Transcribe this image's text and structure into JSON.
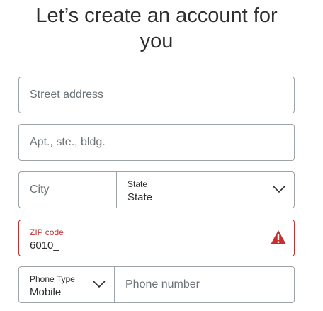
{
  "heading": {
    "line1": "Let’s create an account for",
    "line2": "you"
  },
  "street": {
    "placeholder": "Street address"
  },
  "apt": {
    "placeholder": "Apt., ste., bldg."
  },
  "city": {
    "placeholder": "City"
  },
  "state": {
    "label": "State",
    "value": "State"
  },
  "zip": {
    "label": "ZIP code",
    "value": "6010_",
    "error_color": "#c72e2e"
  },
  "phone_type": {
    "label": "Phone Type",
    "value": "Mobile"
  },
  "phone": {
    "placeholder": "Phone number"
  },
  "icons": {
    "state_chevron": "chevron-down-icon",
    "phone_chevron": "chevron-down-icon",
    "zip_warning": "warning-icon"
  }
}
